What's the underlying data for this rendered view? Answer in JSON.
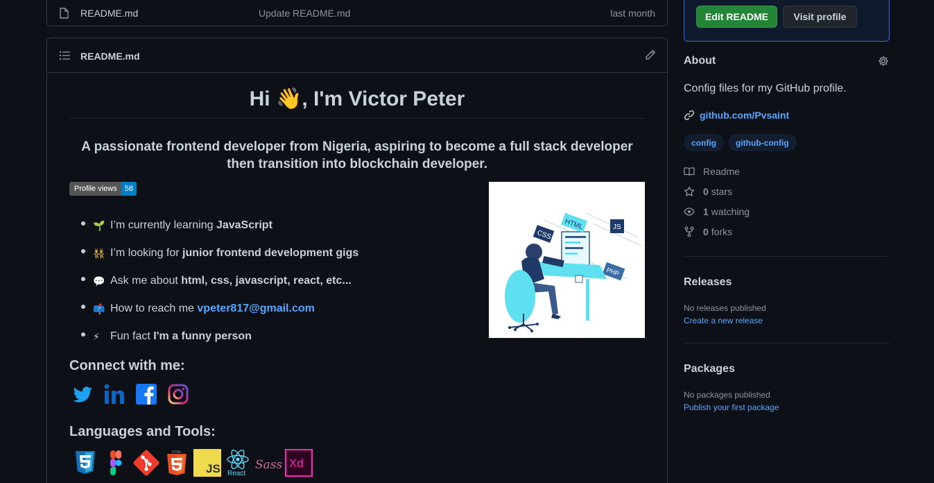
{
  "file_row": {
    "name": "README.md",
    "message": "Update README.md",
    "date": "last month"
  },
  "readme": {
    "header_title": "README.md",
    "greeting_before": "Hi ",
    "greeting_emoji": "👋",
    "greeting_after": ", I'm Victor Peter",
    "tagline": "A passionate frontend developer from Nigeria, aspiring to become a full stack developer then transition into blockchain developer.",
    "badge": {
      "label": "Profile views",
      "value": "58"
    },
    "facts": [
      {
        "emoji": "🌱",
        "text": "I’m currently learning ",
        "bold": "JavaScript"
      },
      {
        "emoji": "👯",
        "text": "I’m looking for ",
        "bold": "junior frontend development gigs"
      },
      {
        "emoji": "💬",
        "text": "Ask me about ",
        "bold": "html, css, javascript, react, etc..."
      },
      {
        "emoji": "📫",
        "text": "How to reach me ",
        "link": "vpeter817@gmail.com"
      },
      {
        "emoji": "⚡",
        "text": "Fun fact ",
        "bold": "I'm a funny person"
      }
    ],
    "illustration_labels": {
      "html": "HTML",
      "css": "CSS",
      "js": "JS",
      "php": "PHP"
    },
    "connect_title": "Connect with me:",
    "socials": [
      "twitter-icon",
      "linkedin-icon",
      "facebook-icon",
      "instagram-icon"
    ],
    "languages_title": "Languages and Tools:",
    "tools": [
      "css3-icon",
      "figma-icon",
      "git-icon",
      "html5-icon",
      "javascript-icon",
      "react-icon",
      "sass-icon",
      "xd-icon"
    ],
    "tool_labels": {
      "html5_top": "HTML",
      "js": "JS",
      "react": "React",
      "sass": "Sass",
      "xd": "Xd"
    }
  },
  "sidebar": {
    "edit_button": "Edit README",
    "visit_button": "Visit profile",
    "about_title": "About",
    "about_desc": "Config files for my GitHub profile.",
    "link": "github.com/Pvsaint",
    "topics": [
      "config",
      "github-config"
    ],
    "readme_label": "Readme",
    "stars_count": "0",
    "stars_label": "stars",
    "watching_count": "1",
    "watching_label": "watching",
    "forks_count": "0",
    "forks_label": "forks",
    "releases_title": "Releases",
    "releases_note": "No releases published",
    "releases_link": "Create a new release",
    "packages_title": "Packages",
    "packages_note": "No packages published",
    "packages_link": "Publish your first package"
  },
  "colors": {
    "background": "#0d1117",
    "border": "#30363d",
    "link": "#58a6ff",
    "green_button": "#238636",
    "badge_value": "#007ec6"
  }
}
